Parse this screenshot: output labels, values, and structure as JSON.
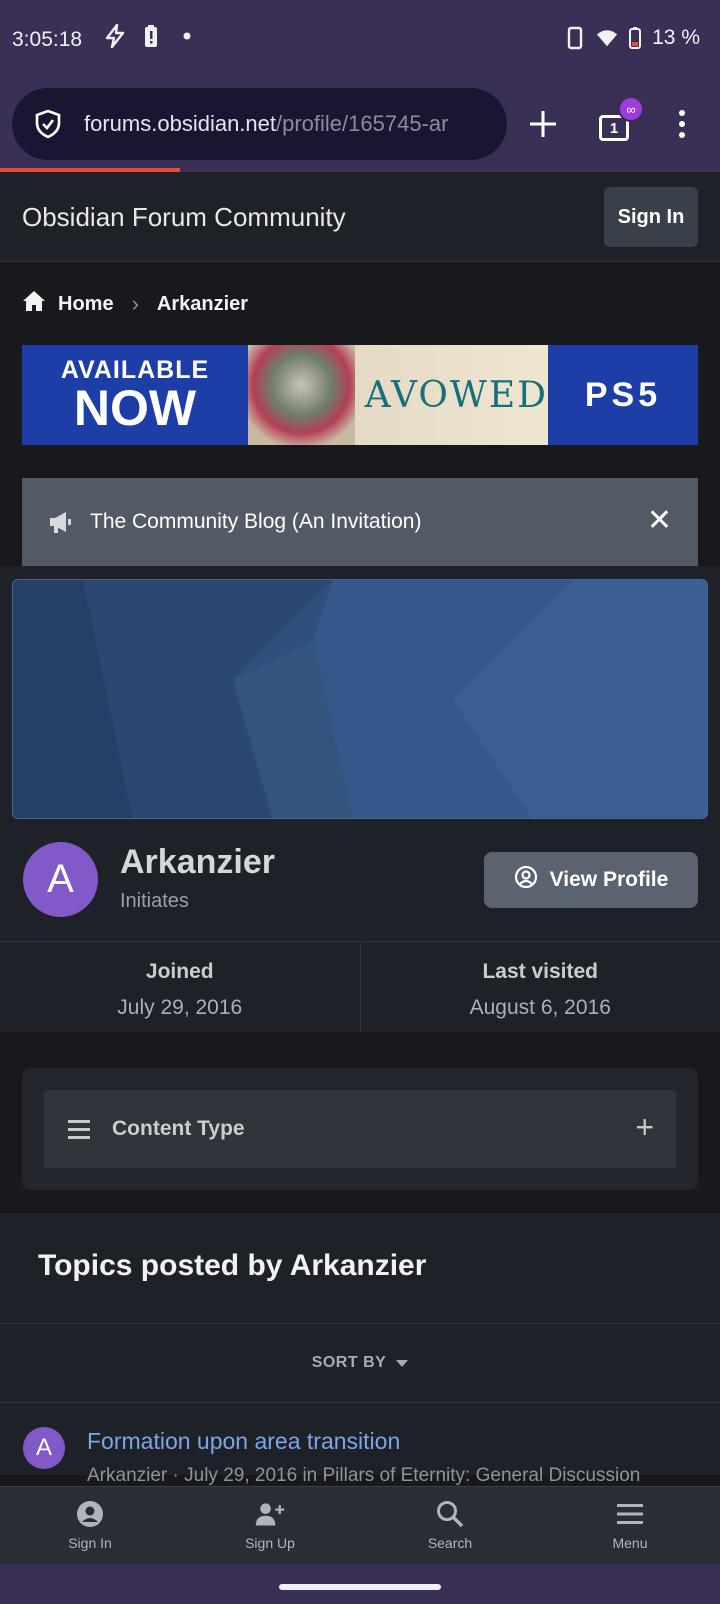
{
  "status_bar": {
    "time": "3:05:18",
    "battery": "13 %",
    "icons": [
      "flash-icon",
      "battery-alert-icon",
      "dot-icon",
      "phone-icon",
      "wifi-icon",
      "battery-icon"
    ]
  },
  "browser": {
    "url_host": "forums.obsidian.net",
    "url_path": "/profile/165745-ar",
    "tab_count": "1",
    "private_badge": "∞"
  },
  "site": {
    "title": "Obsidian Forum Community",
    "sign_in_label": "Sign In"
  },
  "breadcrumb": {
    "home": "Home",
    "current": "Arkanzier"
  },
  "ad": {
    "available": "AVAILABLE",
    "now": "NOW",
    "game": "AVOWED",
    "platform": "PS5"
  },
  "announcement": {
    "text": "The Community Blog (An Invitation)",
    "close": "✕"
  },
  "profile": {
    "avatar_letter": "A",
    "name": "Arkanzier",
    "group": "Initiates",
    "view_profile_label": "View Profile",
    "joined_label": "Joined",
    "joined_value": "July 29, 2016",
    "last_visited_label": "Last visited",
    "last_visited_value": "August 6, 2016"
  },
  "filter": {
    "label": "Content Type",
    "expand": "+"
  },
  "topics": {
    "heading": "Topics posted by Arkanzier",
    "sort_label": "SORT BY",
    "items": [
      {
        "avatar_letter": "A",
        "title": "Formation upon area transition",
        "meta": "Arkanzier · July 29, 2016 in Pillars of Eternity: General Discussion"
      }
    ]
  },
  "bottom_nav": {
    "items": [
      {
        "label": "Sign In",
        "icon": "user-circle-icon"
      },
      {
        "label": "Sign Up",
        "icon": "user-plus-icon"
      },
      {
        "label": "Search",
        "icon": "search-icon"
      },
      {
        "label": "Menu",
        "icon": "hamburger-menu-icon"
      }
    ]
  }
}
